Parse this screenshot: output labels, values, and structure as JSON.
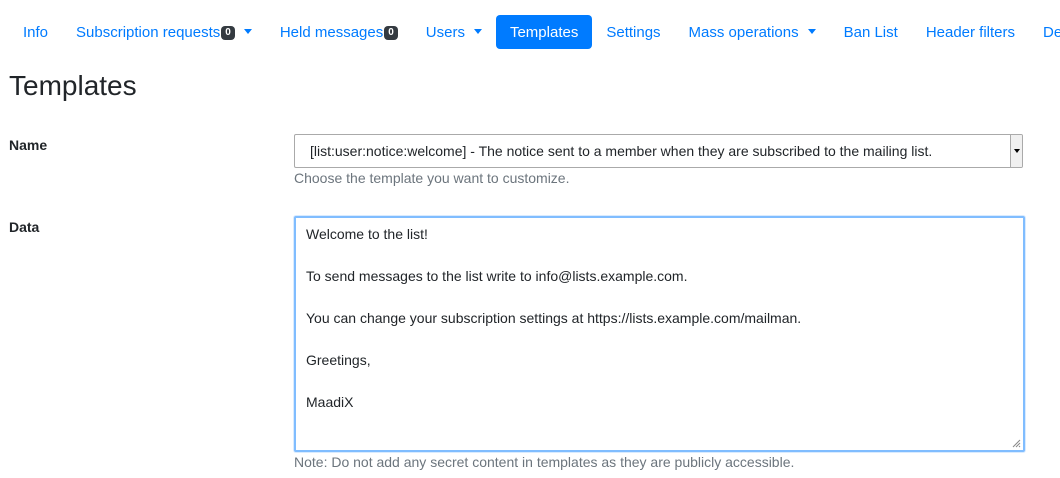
{
  "nav": {
    "items": [
      {
        "label": "Info"
      },
      {
        "label": "Subscription requests",
        "badge": "0",
        "dropdown": true
      },
      {
        "label": "Held messages",
        "badge": "0"
      },
      {
        "label": "Users",
        "dropdown": true
      },
      {
        "label": "Templates",
        "active": true
      },
      {
        "label": "Settings"
      },
      {
        "label": "Mass operations",
        "dropdown": true
      },
      {
        "label": "Ban List"
      },
      {
        "label": "Header filters"
      },
      {
        "label": "Delete"
      }
    ]
  },
  "page": {
    "title": "Templates"
  },
  "form": {
    "name_label": "Name",
    "name_select_value": "[list:user:notice:welcome] - The notice sent to a member when they are subscribed to the mailing list.",
    "name_help": "Choose the template you want to customize.",
    "data_label": "Data",
    "data_value": "Welcome to the list!\n\nTo send messages to the list write to info@lists.example.com.\n\nYou can change your subscription settings at https://lists.example.com/mailman.\n\nGreetings,\n\nMaadiX",
    "data_help": "Note: Do not add any secret content in templates as they are publicly accessible."
  },
  "colors": {
    "accent": "#007bff",
    "badge_bg": "#343a40",
    "focus_border": "#80bdff"
  }
}
